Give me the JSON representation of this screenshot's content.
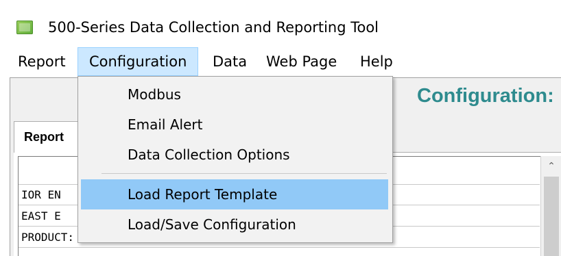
{
  "window": {
    "title": "500-Series Data Collection and Reporting Tool"
  },
  "menubar": {
    "items": [
      {
        "label": "Report"
      },
      {
        "label": "Configuration"
      },
      {
        "label": "Data"
      },
      {
        "label": "Web Page"
      },
      {
        "label": "Help"
      }
    ],
    "active": "Configuration"
  },
  "main": {
    "heading": "Configuration:",
    "tab_label": "Report",
    "rows": [
      {
        "text": "IOR EN"
      },
      {
        "text": "EAST E"
      },
      {
        "text": "PRODUCT: STANDARD DIESEL"
      }
    ]
  },
  "dropdown": {
    "items": [
      {
        "label": "Modbus"
      },
      {
        "label": "Email Alert"
      },
      {
        "label": "Data Collection Options"
      },
      {
        "label": "Load Report Template"
      },
      {
        "label": "Load/Save Configuration"
      }
    ],
    "highlighted": "Load Report Template"
  },
  "icons": {
    "app": "app-icon",
    "scroll_up": "chevron-up-icon"
  },
  "colors": {
    "heading": "#2e8b8e",
    "menu_active_bg": "#cce8ff",
    "dropdown_highlight": "#91c9f7"
  }
}
